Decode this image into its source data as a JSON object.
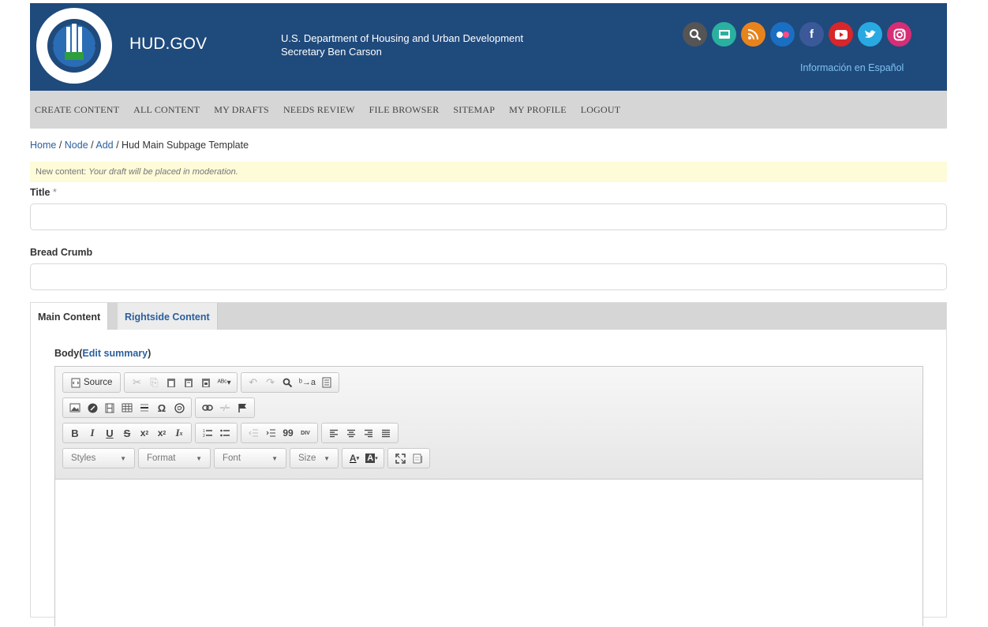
{
  "header": {
    "site_name": "HUD.GOV",
    "agency_line1": "U.S. Department of Housing and Urban Development",
    "agency_line2": "Secretary Ben Carson",
    "espanol_link": "Información en Español",
    "social_icons": [
      {
        "name": "search-icon",
        "color": "#555555"
      },
      {
        "name": "email-icon",
        "color": "#2ab0a0"
      },
      {
        "name": "rss-icon",
        "color": "#e8831c"
      },
      {
        "name": "flickr-icon",
        "color": "#1b6fc2"
      },
      {
        "name": "facebook-icon",
        "color": "#3b5998"
      },
      {
        "name": "youtube-icon",
        "color": "#d9262a"
      },
      {
        "name": "twitter-icon",
        "color": "#29a9e1"
      },
      {
        "name": "instagram-icon",
        "color": "#d62e74"
      }
    ],
    "colors": {
      "header_bg": "#1f4a7c",
      "link": "#2b5f9e"
    }
  },
  "nav": {
    "items": [
      "CREATE CONTENT",
      "ALL CONTENT",
      "MY DRAFTS",
      "NEEDS REVIEW",
      "FILE BROWSER",
      "SITEMAP",
      "MY PROFILE",
      "LOGOUT"
    ]
  },
  "breadcrumb": {
    "home": "Home",
    "sep1": " / ",
    "node": "Node",
    "sep2": " / ",
    "add": "Add",
    "current": " / Hud Main Subpage Template"
  },
  "notice": {
    "prefix": "New content: ",
    "message": "Your draft will be placed in moderation."
  },
  "form": {
    "title_label": "Title",
    "required_mark": " *",
    "title_value": "",
    "breadcrumb_label": "Bread Crumb",
    "breadcrumb_value": ""
  },
  "tabs": {
    "main": "Main Content",
    "rightside": "Rightside Content"
  },
  "body": {
    "label": "Body",
    "paren_open": "(",
    "edit_summary": "Edit summary",
    "paren_close": ")"
  },
  "editor": {
    "source_label": "Source",
    "bold": "B",
    "italic": "I",
    "underline": "U",
    "strike": "S",
    "omega": "Ω",
    "quote": "99",
    "div": "DIV",
    "styles": "Styles",
    "format": "Format",
    "font": "Font",
    "size": "Size",
    "font_color": "A",
    "bg_color": "A"
  }
}
